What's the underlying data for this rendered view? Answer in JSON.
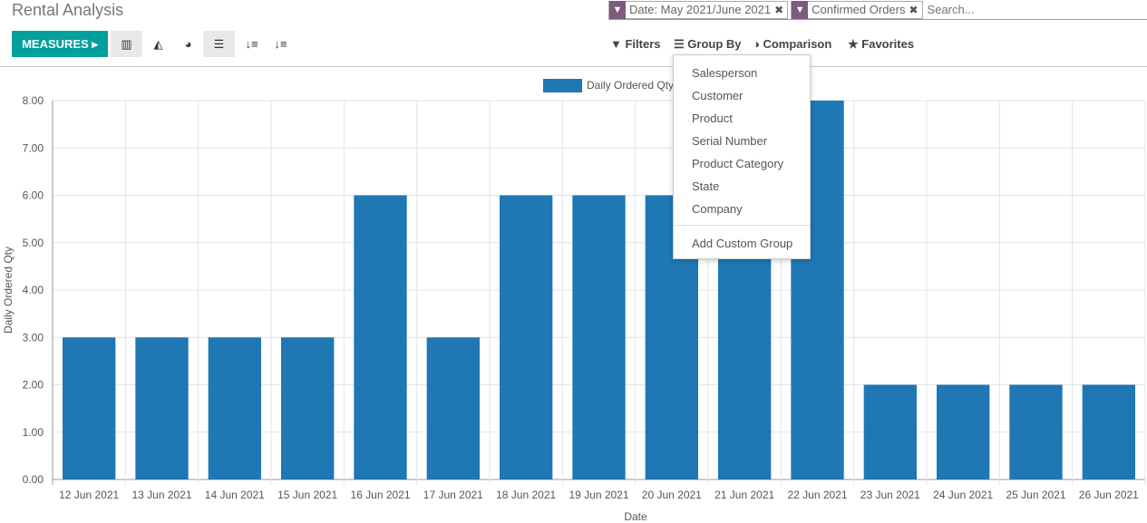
{
  "header": {
    "title": "Rental Analysis"
  },
  "search": {
    "facets": [
      {
        "icon": "filter-icon",
        "label": "Date: May 2021/June 2021"
      },
      {
        "icon": "filter-icon",
        "label": "Confirmed Orders"
      }
    ],
    "placeholder": "Search..."
  },
  "toolbar": {
    "measures_label": "MEASURES",
    "views": [
      "bar-chart-icon",
      "line-chart-icon",
      "pie-chart-icon",
      "stacked-icon",
      "sort-descending-icon",
      "sort-ascending-icon"
    ]
  },
  "controls": {
    "filters": "Filters",
    "group_by": "Group By",
    "comparison": "Comparison",
    "favorites": "Favorites"
  },
  "group_by_menu": {
    "items": [
      "Salesperson",
      "Customer",
      "Product",
      "Serial Number",
      "Product Category",
      "State",
      "Company"
    ],
    "custom": "Add Custom Group"
  },
  "colors": {
    "bar": "#1f77b4",
    "primary": "#00a09d",
    "facet": "#7c5b7c"
  },
  "chart_data": {
    "type": "bar",
    "categories": [
      "12 Jun 2021",
      "13 Jun 2021",
      "14 Jun 2021",
      "15 Jun 2021",
      "16 Jun 2021",
      "17 Jun 2021",
      "18 Jun 2021",
      "19 Jun 2021",
      "20 Jun 2021",
      "21 Jun 2021",
      "22 Jun 2021",
      "23 Jun 2021",
      "24 Jun 2021",
      "25 Jun 2021",
      "26 Jun 2021"
    ],
    "series": [
      {
        "name": "Daily Ordered Qty",
        "values": [
          3,
          3,
          3,
          3,
          6,
          3,
          6,
          6,
          6,
          6,
          8,
          2,
          2,
          2,
          2
        ]
      }
    ],
    "xlabel": "Date",
    "ylabel": "Daily Ordered Qty",
    "ylim": [
      0,
      8
    ],
    "yticks": [
      "0.00",
      "1.00",
      "2.00",
      "3.00",
      "4.00",
      "5.00",
      "6.00",
      "7.00",
      "8.00"
    ],
    "grid": true,
    "legend": "top"
  }
}
